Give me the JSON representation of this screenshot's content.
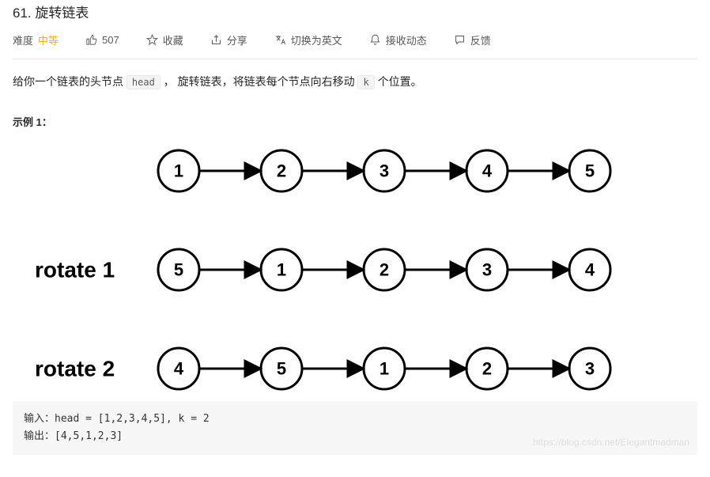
{
  "title": "61. 旋转链表",
  "meta": {
    "difficulty_label": "难度",
    "difficulty_value": "中等",
    "likes": "507",
    "favorite": "收藏",
    "share": "分享",
    "switch_lang": "切换为英文",
    "subscribe": "接收动态",
    "feedback": "反馈"
  },
  "description": {
    "part1": "给你一个链表的头节点 ",
    "code1": "head",
    "part2": " ， 旋转链表，将链表每个节点向右移动 ",
    "code2": "k",
    "part3": " 个位置。"
  },
  "example": {
    "title": "示例 1：",
    "labels": {
      "rotate1": "rotate 1",
      "rotate2": "rotate 2"
    },
    "rows": [
      [
        "1",
        "2",
        "3",
        "4",
        "5"
      ],
      [
        "5",
        "1",
        "2",
        "3",
        "4"
      ],
      [
        "4",
        "5",
        "1",
        "2",
        "3"
      ]
    ],
    "input_label": "输入：",
    "input_value": "head = [1,2,3,4,5], k = 2",
    "output_label": "输出：",
    "output_value": "[4,5,1,2,3]"
  },
  "watermark": "https://blog.csdn.net/Elegantmadman"
}
